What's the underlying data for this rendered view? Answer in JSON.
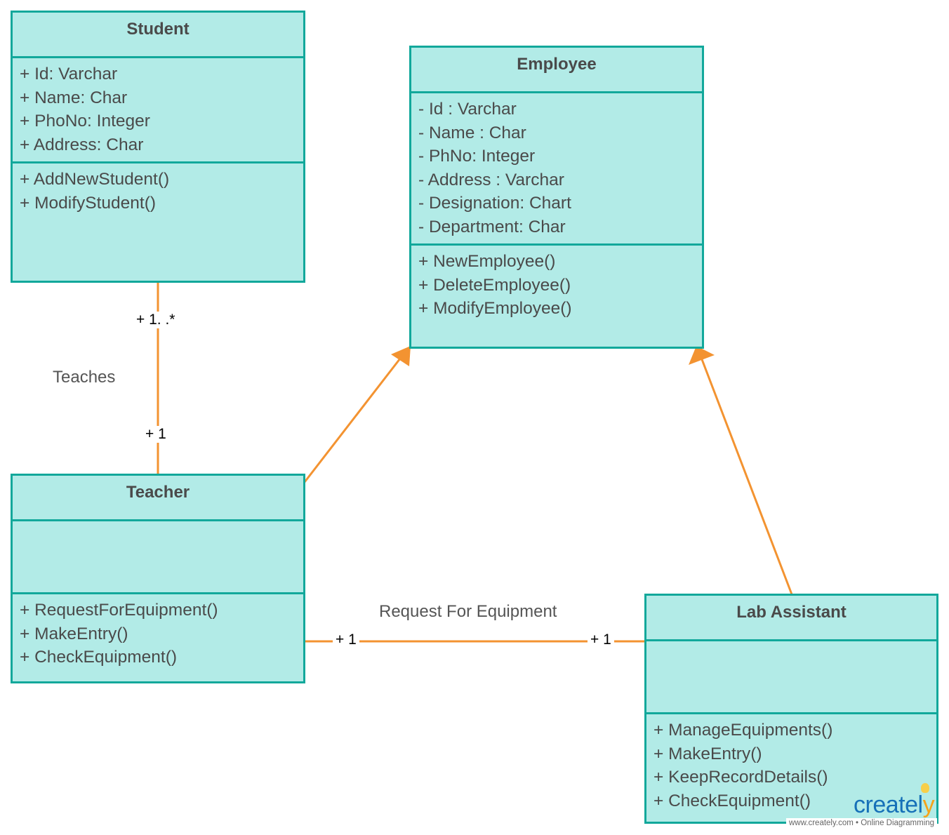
{
  "diagram": {
    "type": "UML class diagram",
    "colors": {
      "class_fill": "#b2ebe7",
      "class_border": "#12a89b",
      "connector": "#f39331",
      "text": "#4a4a4a"
    },
    "classes": {
      "student": {
        "name": "Student",
        "attributes": [
          "+ Id: Varchar",
          "+ Name: Char",
          "+ PhoNo: Integer",
          "+ Address: Char"
        ],
        "methods": [
          "+ AddNewStudent()",
          "+ ModifyStudent()"
        ]
      },
      "employee": {
        "name": "Employee",
        "attributes": [
          "- Id : Varchar",
          "- Name : Char",
          "- PhNo: Integer",
          "- Address : Varchar",
          "- Designation: Chart",
          "- Department: Char"
        ],
        "methods": [
          "+ NewEmployee()",
          "+ DeleteEmployee()",
          "+ ModifyEmployee()"
        ]
      },
      "teacher": {
        "name": "Teacher",
        "attributes": [],
        "methods": [
          "+ RequestForEquipment()",
          "+ MakeEntry()",
          "+ CheckEquipment()"
        ]
      },
      "lab_assistant": {
        "name": "Lab Assistant",
        "attributes": [],
        "methods": [
          "+ ManageEquipments()",
          "+ MakeEntry()",
          "+ KeepRecordDetails()",
          "+ CheckEquipment()"
        ]
      }
    },
    "relationships": {
      "teaches": {
        "label": "Teaches",
        "from": "Teacher",
        "to": "Student",
        "multiplicity_student": "+ 1. .*",
        "multiplicity_teacher": "+ 1"
      },
      "request": {
        "label": "Request For Equipment",
        "from": "Teacher",
        "to": "Lab Assistant",
        "multiplicity_teacher": "+ 1",
        "multiplicity_lab": "+ 1"
      },
      "teacher_inherits": {
        "from": "Teacher",
        "to": "Employee",
        "kind": "generalization"
      },
      "lab_inherits": {
        "from": "Lab Assistant",
        "to": "Employee",
        "kind": "generalization"
      }
    }
  },
  "watermark": {
    "brand": "creately",
    "tagline": "www.creately.com • Online Diagramming"
  }
}
